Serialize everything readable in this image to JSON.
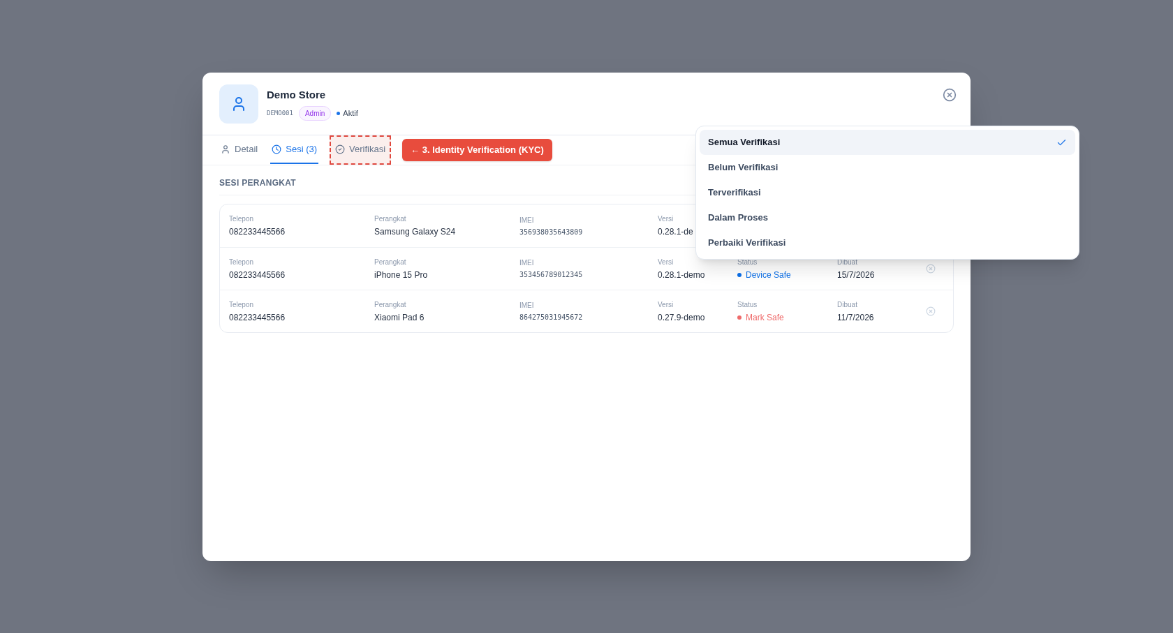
{
  "profile": {
    "name": "Demo Store",
    "code": "DEMO001",
    "role": "Admin",
    "status": "Aktif"
  },
  "tabs": [
    {
      "label": "Detail",
      "selected": false,
      "highlighted": false
    },
    {
      "label": "Sesi (3)",
      "selected": true,
      "highlighted": false
    },
    {
      "label": "Verifikasi",
      "selected": false,
      "highlighted": true
    }
  ],
  "annotation": "← 3. Identity Verification (KYC)",
  "section_title": "SESI PERANGKAT",
  "sessions": [
    {
      "phone_label": "Telepon",
      "phone": "082233445566",
      "device_label": "Perangkat",
      "device": "Samsung Galaxy S24",
      "imei_label": "IMEI",
      "imei": "356938035643809",
      "version_label": "Versi",
      "version": "0.28.1-de"
    },
    {
      "phone_label": "Telepon",
      "phone": "082233445566",
      "device_label": "Perangkat",
      "device": "iPhone 15 Pro",
      "imei_label": "IMEI",
      "imei": "353456789012345",
      "version_label": "Versi",
      "version": "0.28.1-demo",
      "status_label": "Status",
      "status": "Device Safe",
      "color": "#0b6fe8",
      "created_label": "Dibuat",
      "created": "15/7/2026"
    },
    {
      "phone_label": "Telepon",
      "phone": "082233445566",
      "device_label": "Perangkat",
      "device": "Xiaomi Pad 6",
      "imei_label": "IMEI",
      "imei": "864275031945672",
      "version_label": "Versi",
      "version": "0.27.9-demo",
      "status_label": "Status",
      "status": "Mark Safe",
      "color": "#ef6b6b",
      "created_label": "Dibuat",
      "created": "11/7/2026"
    }
  ],
  "filter_menu": [
    {
      "label": "Semua Verifikasi",
      "selected": true
    },
    {
      "label": "Belum Verifikasi",
      "selected": false
    },
    {
      "label": "Terverifikasi",
      "selected": false
    },
    {
      "label": "Dalam Proses",
      "selected": false
    },
    {
      "label": "Perbaiki Verifikasi",
      "selected": false
    }
  ]
}
